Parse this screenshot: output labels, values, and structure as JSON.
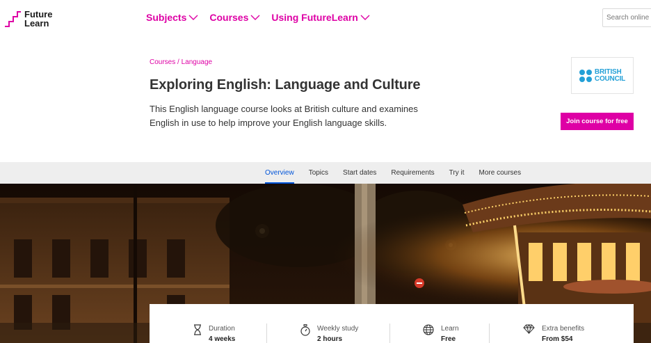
{
  "header": {
    "logo_line1": "Future",
    "logo_line2": "Learn",
    "nav": [
      "Subjects",
      "Courses",
      "Using FutureLearn"
    ],
    "search_placeholder": "Search online courses"
  },
  "course": {
    "breadcrumb": [
      "Courses",
      "Language"
    ],
    "breadcrumb_sep": "/",
    "title": "Exploring English: Language and Culture",
    "description": "This English language course looks at British culture and examines English in use to help improve your English language skills.",
    "partner_logo_text": [
      "BRITISH",
      "COUNCIL"
    ],
    "join_button": "Join course for free"
  },
  "tabs": [
    "Overview",
    "Topics",
    "Start dates",
    "Requirements",
    "Try it",
    "More courses"
  ],
  "active_tab": "Overview",
  "stats": [
    {
      "label": "Duration",
      "value": "4 weeks",
      "icon": "hourglass-icon"
    },
    {
      "label": "Weekly study",
      "value": "2 hours",
      "icon": "stopwatch-icon"
    },
    {
      "label": "Learn",
      "value": "Free",
      "icon": "globe-icon"
    },
    {
      "label": "Extra benefits",
      "value": "From $54",
      "icon": "diamond-icon"
    }
  ],
  "colors": {
    "brand_pink": "#de00a5",
    "active_tab_blue": "#0054d9",
    "british_council_blue": "#23a0d7",
    "tab_bar_bg": "#eeeeee"
  }
}
